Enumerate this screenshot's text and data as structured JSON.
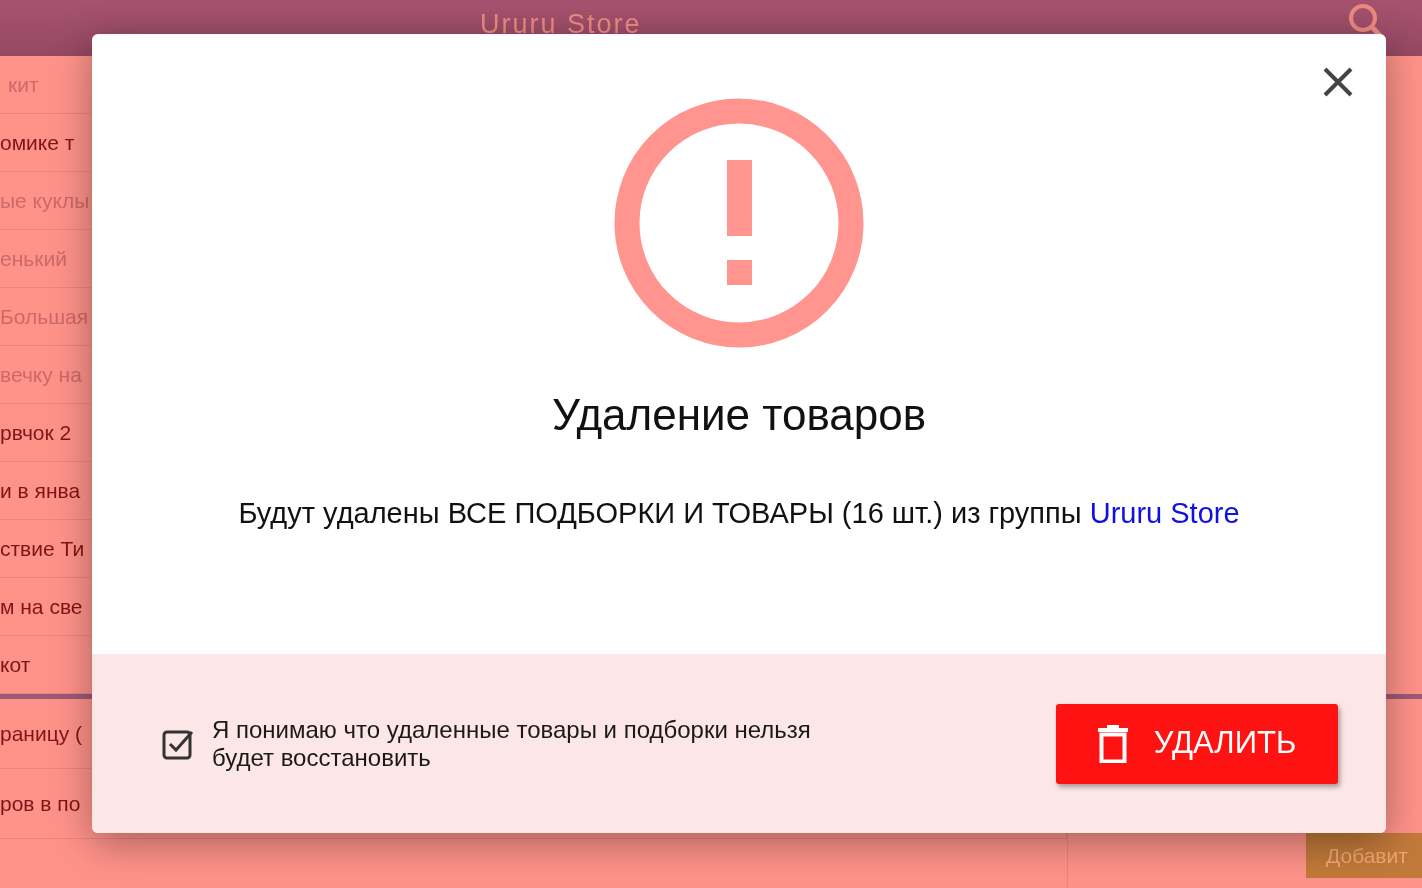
{
  "header": {
    "title": "Ururu Store"
  },
  "background_list": [
    {
      "text": "кит",
      "dimmed": true
    },
    {
      "text": "омике т",
      "dimmed": false
    },
    {
      "text": "ые куклы",
      "dimmed": true
    },
    {
      "text": "енький",
      "dimmed": true
    },
    {
      "text": "Большая",
      "dimmed": true
    },
    {
      "text": "вечку на",
      "dimmed": true
    },
    {
      "text": "рвчок 2",
      "dimmed": false
    },
    {
      "text": "и в янва",
      "dimmed": false
    },
    {
      "text": "ствие Ти",
      "dimmed": false
    },
    {
      "text": "м на све",
      "dimmed": false
    },
    {
      "text": "кот",
      "dimmed": false
    }
  ],
  "background_list_2": [
    {
      "text": "раницу ("
    },
    {
      "text": "ров в по"
    }
  ],
  "background_button": "Добавит",
  "dialog": {
    "title": "Удаление товаров",
    "message": "Будут удалены ВСЕ ПОДБОРКИ И ТОВАРЫ (16 шт.) из группы",
    "link": "Ururu Store",
    "confirm": {
      "label": "Я понимаю что удаленные товары и подборки нельзя будет восстановить",
      "checked": true
    },
    "delete_button": "УДАЛИТЬ"
  }
}
